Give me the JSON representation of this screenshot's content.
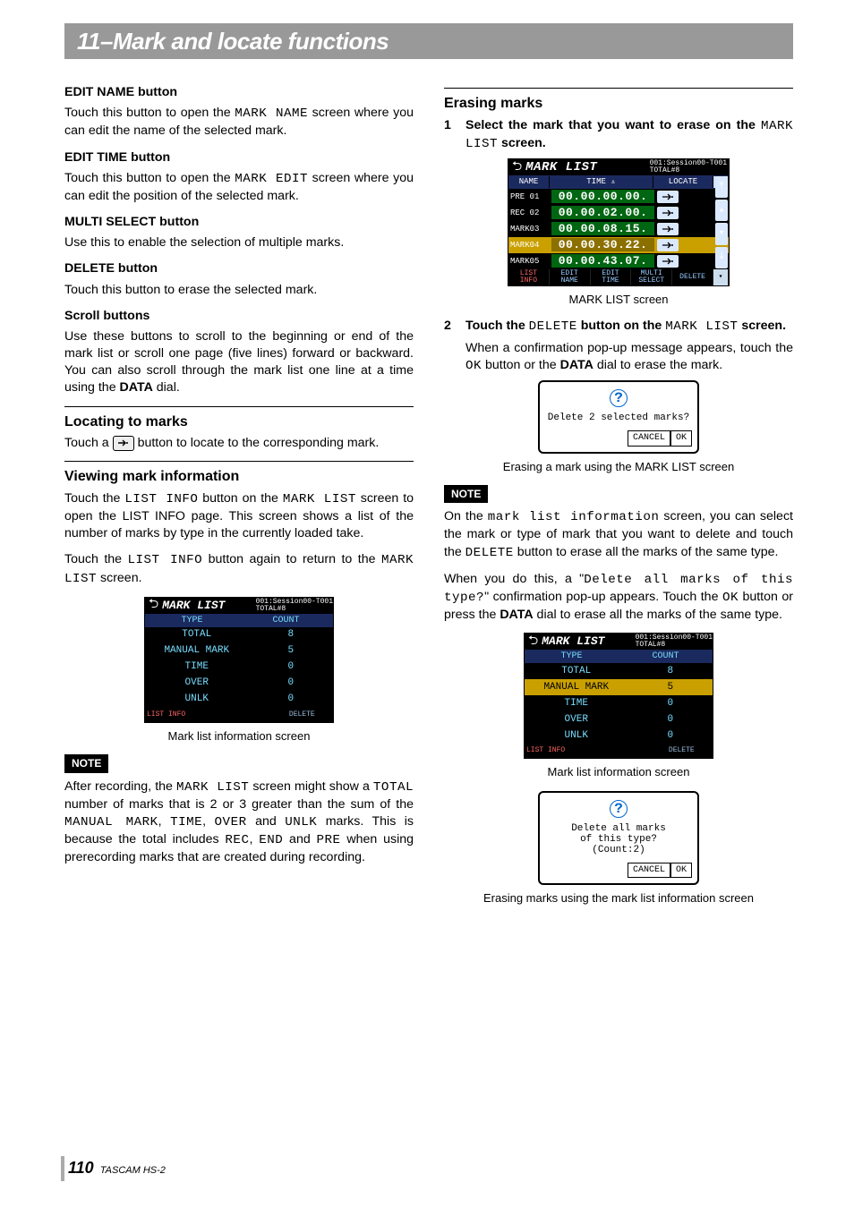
{
  "header": {
    "title": "11–Mark and locate functions"
  },
  "left": {
    "s1h": "EDIT NAME button",
    "s1p_a": "Touch this button to open the ",
    "s1p_m": "MARK NAME",
    "s1p_b": " screen where you can edit the name of the selected mark.",
    "s2h": "EDIT TIME button",
    "s2p_a": "Touch this button to open the ",
    "s2p_m": "MARK EDIT",
    "s2p_b": " screen where you can edit the position of the selected mark.",
    "s3h": "MULTI SELECT button",
    "s3p": "Use this to enable the selection of multiple marks.",
    "s4h": "DELETE button",
    "s4p": "Touch this button to erase the selected mark.",
    "s5h": "Scroll buttons",
    "s5p_a": "Use these buttons to scroll to the beginning or end of the mark list or scroll one page (five lines) forward or backward. You can also scroll through the mark list one line at a time using the ",
    "s5p_b": "DATA",
    "s5p_c": " dial.",
    "loc_h": "Locating to marks",
    "loc_a": "Touch a ",
    "loc_b": " button to locate to the corresponding mark.",
    "view_h": "Viewing mark information",
    "view_p1_a": "Touch the ",
    "view_p1_m1": "LIST INFO",
    "view_p1_b": " button on the ",
    "view_p1_m2": "MARK LIST",
    "view_p1_c": " screen to open the LIST INFO page. This screen shows a list of the number of marks by type in the currently loaded take.",
    "view_p2_a": "Touch the ",
    "view_p2_m1": "LIST INFO",
    "view_p2_b": " button again to return to the ",
    "view_p2_m2": "MARK LIST",
    "view_p2_c": " screen.",
    "cap1": "Mark list information screen",
    "note": "NOTE",
    "note1_a": "After recording, the ",
    "note1_m1": "MARK LIST",
    "note1_b": " screen might show a ",
    "note1_m2": "TOTAL",
    "note1_c": " number of marks that is 2 or 3 greater than the sum of the ",
    "note1_m3": "MANUAL MARK",
    "note1_d": ", ",
    "note1_m4": "TIME",
    "note1_e": ", ",
    "note1_m5": "OVER",
    "note1_f": " and ",
    "note1_m6": "UNLK",
    "note1_g": " marks. This is because the total includes ",
    "note1_m7": "REC",
    "note1_h": ", ",
    "note1_m8": "END",
    "note1_i": " and ",
    "note1_m9": "PRE",
    "note1_j": " when using prerecording marks that are created during recording."
  },
  "right": {
    "erase_h": "Erasing marks",
    "st1_n": "1",
    "st1_a": "Select the mark that you want to erase on the ",
    "st1_m": "MARK LIST",
    "st1_b": " screen.",
    "cap_ml": "MARK LIST screen",
    "st2_n": "2",
    "st2_a": "Touch the ",
    "st2_m1": "DELETE",
    "st2_b": " button on the ",
    "st2_m2": "MARK LIST",
    "st2_c": " screen.",
    "st2_p_a": "When a confirmation pop-up message appears, touch the ",
    "st2_p_m": "OK",
    "st2_p_b": " button or the ",
    "st2_p_bold": "DATA",
    "st2_p_c": " dial to erase the mark.",
    "dlg1_msg": "Delete 2 selected marks?",
    "cancel": "CANCEL",
    "ok": "OK",
    "cap_dlg1": "Erasing a mark using the MARK LIST screen",
    "note2_a": "On the ",
    "note2_m1": "mark list information",
    "note2_b": " screen, you can select the mark or type of mark that you want to delete and touch the ",
    "note2_m2": "DELETE",
    "note2_c": " button to erase all the marks of the same type.",
    "note2_d": "When you do this, a \"",
    "note2_m3": "Delete all marks of this type?",
    "note2_e": "\" confirmation pop-up appears. Touch the ",
    "note2_m4": "OK",
    "note2_f": " button or press the ",
    "note2_bold": "DATA",
    "note2_g": " dial to erase all the marks of the same type.",
    "cap2": "Mark list information screen",
    "dlg2_l1": "Delete all marks",
    "dlg2_l2": "of this type?",
    "dlg2_l3": "(Count:2)",
    "cap_dlg2": "Erasing marks using the mark list information screen"
  },
  "mark_list": {
    "title": "MARK LIST",
    "meta1": "001:Session00-T001",
    "meta2": "TOTAL#8",
    "col_name": "NAME",
    "col_time": "TIME",
    "col_loc": "LOCATE",
    "rows": [
      {
        "name": "PRE 01",
        "time": "00.00.00.00.",
        "sel": false
      },
      {
        "name": "REC 02",
        "time": "00.00.02.00.",
        "sel": false
      },
      {
        "name": "MARK03",
        "time": "00.00.08.15.",
        "sel": false
      },
      {
        "name": "MARK04",
        "time": "00.00.30.22.",
        "sel": true
      },
      {
        "name": "MARK05",
        "time": "00.00.43.07.",
        "sel": false
      }
    ],
    "bot": [
      "LIST\nINFO",
      "EDIT\nNAME",
      "EDIT\nTIME",
      "MULTI\nSELECT",
      "DELETE"
    ]
  },
  "info_table": {
    "title": "MARK LIST",
    "meta1": "001:Session00-T001",
    "meta2": "TOTAL#8",
    "h1": "TYPE",
    "h2": "COUNT",
    "rows": [
      {
        "t": "TOTAL",
        "c": "8",
        "sel": false
      },
      {
        "t": "MANUAL MARK",
        "c": "5",
        "sel": false
      },
      {
        "t": "TIME",
        "c": "0",
        "sel": false
      },
      {
        "t": "OVER",
        "c": "0",
        "sel": false
      },
      {
        "t": "UNLK",
        "c": "0",
        "sel": false
      }
    ],
    "bot_l": "LIST\nINFO",
    "bot_r": "DELETE"
  },
  "info_table2_sel": 1,
  "footer": {
    "page": "110",
    "model": "TASCAM HS-2"
  }
}
